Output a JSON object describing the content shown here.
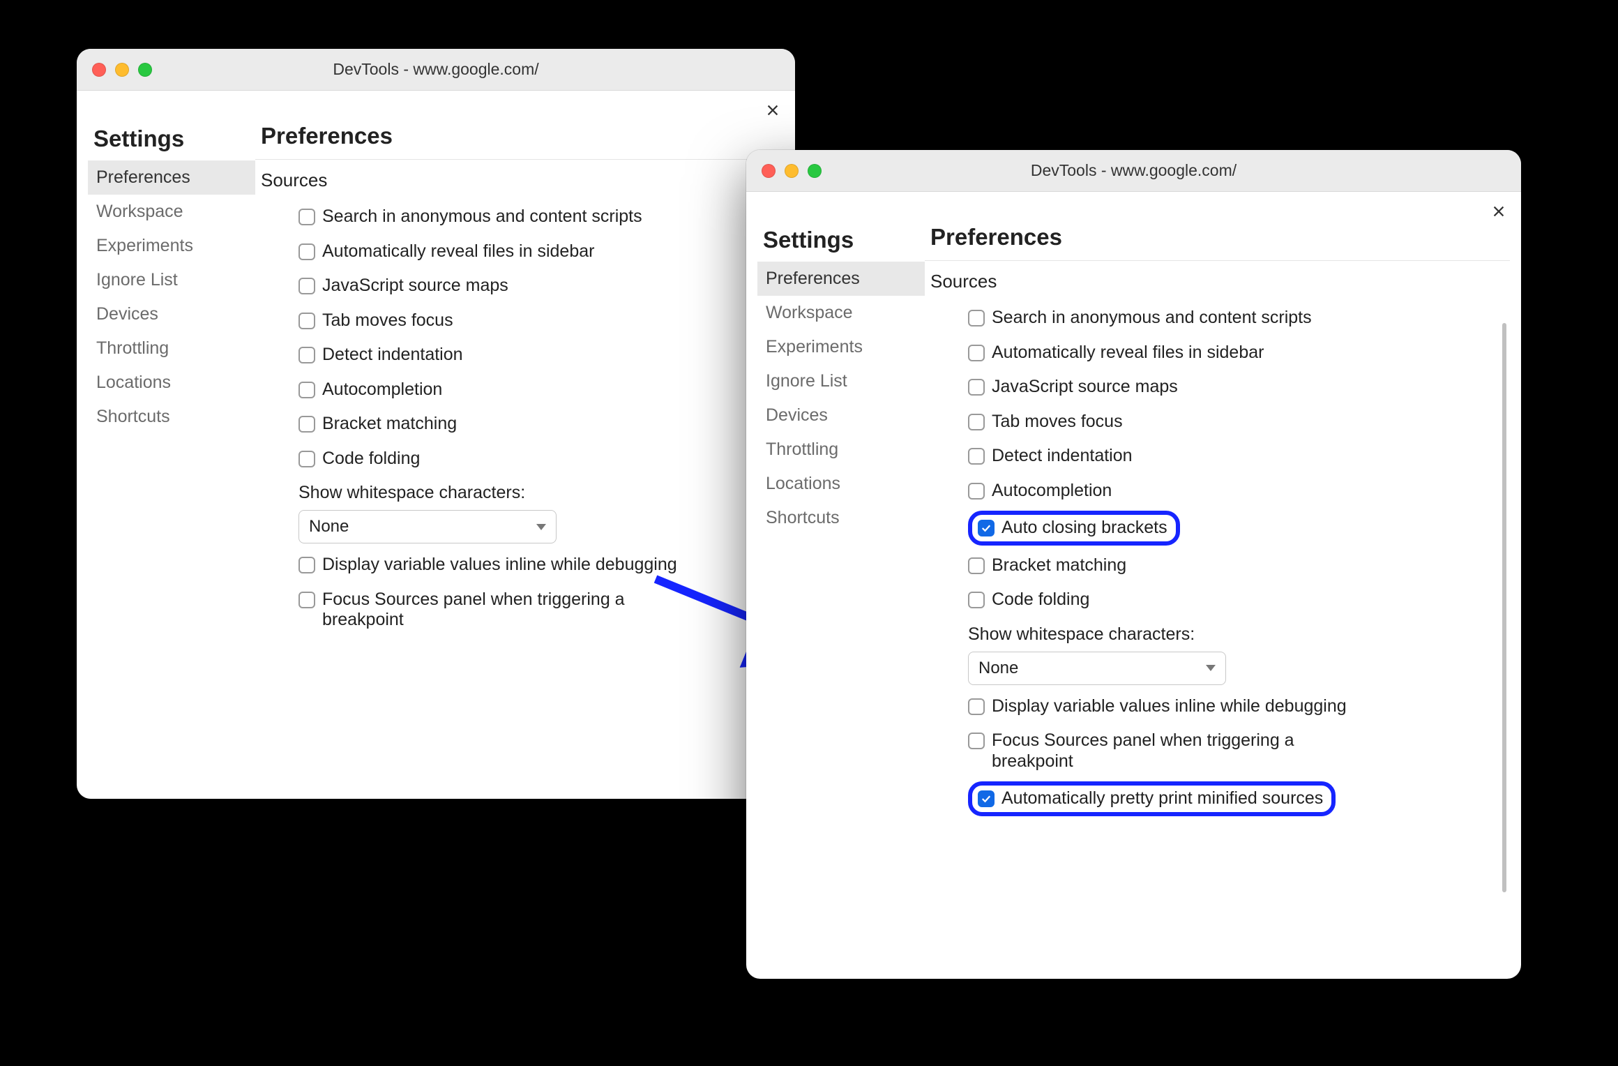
{
  "colors": {
    "accent": "#1625ff",
    "checkboxChecked": "#1169e6"
  },
  "windowLeft": {
    "title": "DevTools - www.google.com/",
    "sidebar": {
      "heading": "Settings",
      "items": [
        {
          "label": "Preferences",
          "active": true
        },
        {
          "label": "Workspace",
          "active": false
        },
        {
          "label": "Experiments",
          "active": false
        },
        {
          "label": "Ignore List",
          "active": false
        },
        {
          "label": "Devices",
          "active": false
        },
        {
          "label": "Throttling",
          "active": false
        },
        {
          "label": "Locations",
          "active": false
        },
        {
          "label": "Shortcuts",
          "active": false
        }
      ]
    },
    "main": {
      "heading": "Preferences",
      "sectionTitle": "Sources",
      "options": [
        {
          "label": "Search in anonymous and content scripts",
          "checked": false
        },
        {
          "label": "Automatically reveal files in sidebar",
          "checked": false
        },
        {
          "label": "JavaScript source maps",
          "checked": false
        },
        {
          "label": "Tab moves focus",
          "checked": false
        },
        {
          "label": "Detect indentation",
          "checked": false
        },
        {
          "label": "Autocompletion",
          "checked": false
        },
        {
          "label": "Bracket matching",
          "checked": false
        },
        {
          "label": "Code folding",
          "checked": false
        }
      ],
      "whitespace": {
        "label": "Show whitespace characters:",
        "value": "None"
      },
      "extraOptions": [
        {
          "label": "Display variable values inline while debugging",
          "checked": false
        },
        {
          "label": "Focus Sources panel when triggering a breakpoint",
          "checked": false
        }
      ]
    }
  },
  "windowRight": {
    "title": "DevTools - www.google.com/",
    "sidebar": {
      "heading": "Settings",
      "items": [
        {
          "label": "Preferences",
          "active": true
        },
        {
          "label": "Workspace",
          "active": false
        },
        {
          "label": "Experiments",
          "active": false
        },
        {
          "label": "Ignore List",
          "active": false
        },
        {
          "label": "Devices",
          "active": false
        },
        {
          "label": "Throttling",
          "active": false
        },
        {
          "label": "Locations",
          "active": false
        },
        {
          "label": "Shortcuts",
          "active": false
        }
      ]
    },
    "main": {
      "heading": "Preferences",
      "sectionTitle": "Sources",
      "options": [
        {
          "label": "Search in anonymous and content scripts",
          "checked": false,
          "highlight": false
        },
        {
          "label": "Automatically reveal files in sidebar",
          "checked": false,
          "highlight": false
        },
        {
          "label": "JavaScript source maps",
          "checked": false,
          "highlight": false
        },
        {
          "label": "Tab moves focus",
          "checked": false,
          "highlight": false
        },
        {
          "label": "Detect indentation",
          "checked": false,
          "highlight": false
        },
        {
          "label": "Autocompletion",
          "checked": false,
          "highlight": false
        },
        {
          "label": "Auto closing brackets",
          "checked": true,
          "highlight": true
        },
        {
          "label": "Bracket matching",
          "checked": false,
          "highlight": false
        },
        {
          "label": "Code folding",
          "checked": false,
          "highlight": false
        }
      ],
      "whitespace": {
        "label": "Show whitespace characters:",
        "value": "None"
      },
      "extraOptions": [
        {
          "label": "Display variable values inline while debugging",
          "checked": false,
          "highlight": false
        },
        {
          "label": "Focus Sources panel when triggering a breakpoint",
          "checked": false,
          "highlight": false
        },
        {
          "label": "Automatically pretty print minified sources",
          "checked": true,
          "highlight": true
        }
      ]
    }
  }
}
